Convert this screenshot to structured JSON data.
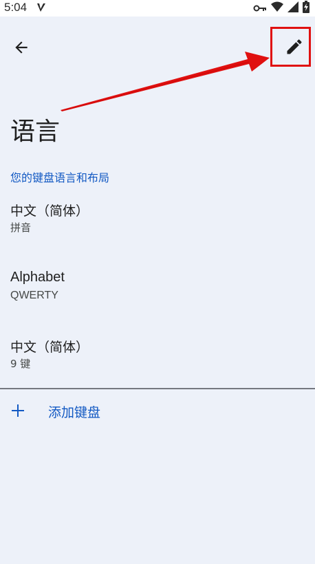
{
  "status_bar": {
    "time": "5:04",
    "icons": [
      "app-notification-icon",
      "vpn-key-icon",
      "wifi-icon",
      "signal-icon",
      "battery-charging-icon"
    ]
  },
  "toolbar": {
    "back_icon": "arrow-back-icon",
    "edit_icon": "pencil-edit-icon"
  },
  "annotation": {
    "highlight_color": "#e01010"
  },
  "page": {
    "title": "语言",
    "section_header": "您的键盘语言和布局"
  },
  "languages": [
    {
      "title": "中文（简体）",
      "subtitle": "拼音"
    },
    {
      "title": "Alphabet",
      "subtitle": "QWERTY"
    },
    {
      "title": "中文（简体）",
      "subtitle": "9 键"
    }
  ],
  "add_keyboard": {
    "icon": "plus-icon",
    "label": "添加键盘"
  },
  "colors": {
    "background": "#edf1f9",
    "accent": "#1259c3",
    "text": "#1f1f1f"
  }
}
